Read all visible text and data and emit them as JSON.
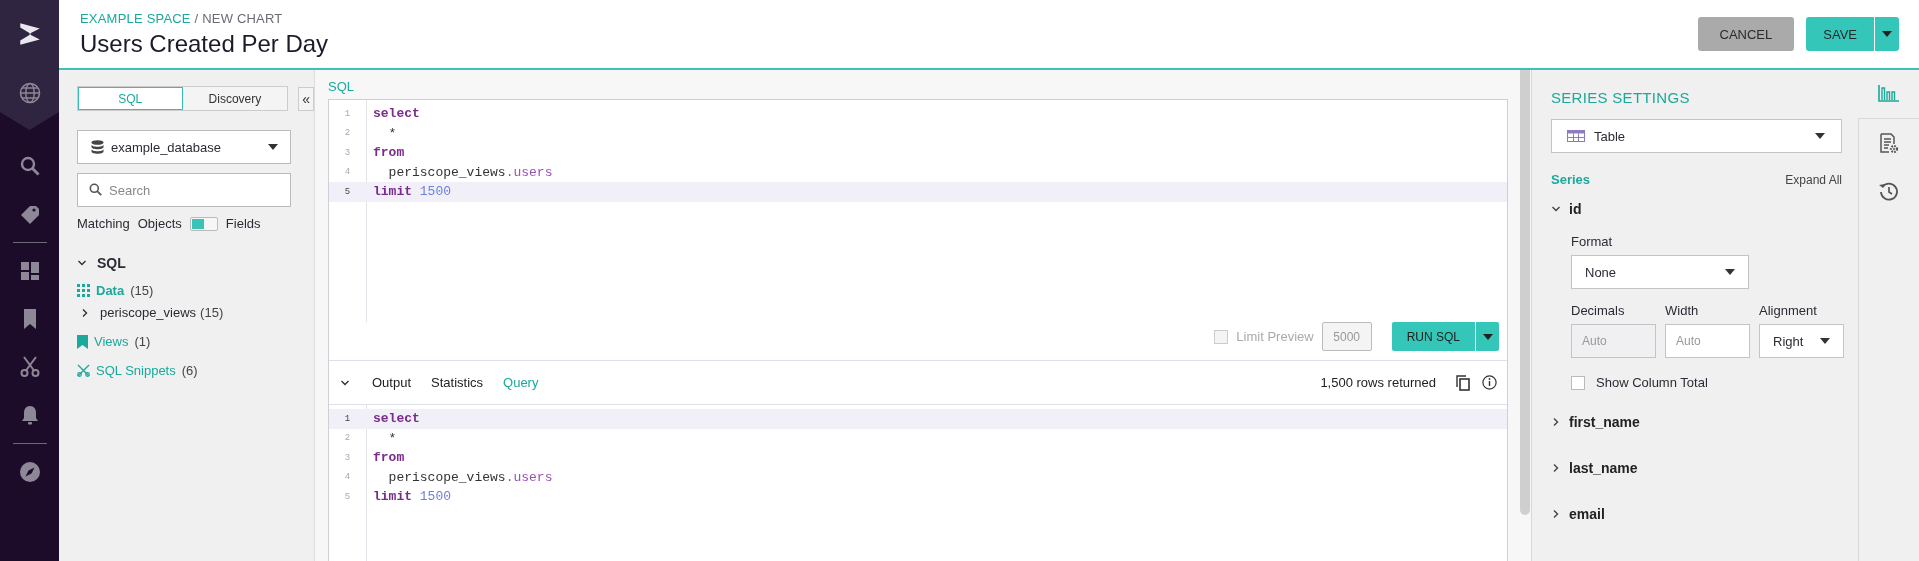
{
  "header": {
    "breadcrumb": {
      "space": "EXAMPLE SPACE",
      "page": "/ NEW CHART"
    },
    "title": "Users Created Per Day",
    "cancel": "CANCEL",
    "save": "SAVE"
  },
  "left_panel": {
    "modes": [
      {
        "label": "SQL",
        "selected": true
      },
      {
        "label": "Discovery",
        "selected": false
      }
    ],
    "collapse": "«",
    "database": "example_database",
    "search": {
      "placeholder": "Search"
    },
    "matching": {
      "label": "Matching",
      "off_label": "Objects",
      "on_label": "Fields",
      "on": false
    },
    "tree": {
      "label": "SQL",
      "expanded": true,
      "groups": [
        {
          "kind": "data",
          "label": "Data",
          "count": "(15)",
          "children": [
            {
              "label": "periscope_views",
              "count": "(15)",
              "expanded": false
            }
          ]
        },
        {
          "kind": "views",
          "label": "Views",
          "count": "(1)"
        },
        {
          "kind": "snippets",
          "label": "SQL Snippets",
          "count": "(6)"
        }
      ]
    }
  },
  "editor": {
    "label": "SQL",
    "lines": [
      {
        "number": "1",
        "current": false,
        "tokens": [
          {
            "kind": "keyword",
            "text": "select"
          }
        ]
      },
      {
        "number": "2",
        "current": false,
        "tokens": [
          {
            "kind": "plain",
            "text": "  *"
          }
        ]
      },
      {
        "number": "3",
        "current": false,
        "tokens": [
          {
            "kind": "keyword",
            "text": "from"
          }
        ]
      },
      {
        "number": "4",
        "current": false,
        "tokens": [
          {
            "kind": "plain",
            "text": "  periscope_views"
          },
          {
            "kind": "member",
            "text": ".users"
          }
        ]
      },
      {
        "number": "5",
        "current": true,
        "tokens": [
          {
            "kind": "keyword",
            "text": "limit"
          },
          {
            "kind": "number",
            "text": "1500"
          }
        ]
      }
    ],
    "limit_preview": {
      "label": "Limit Preview",
      "checked": false,
      "disabled": true,
      "value": "5000"
    },
    "run": "RUN SQL"
  },
  "output": {
    "expanded": true,
    "tabs": [
      {
        "label": "Output",
        "selected": false
      },
      {
        "label": "Statistics",
        "selected": false
      },
      {
        "label": "Query",
        "selected": true
      }
    ],
    "status": "1,500 rows returned",
    "lines": [
      {
        "number": "1",
        "current": true,
        "tokens": [
          {
            "kind": "keyword",
            "text": "select"
          }
        ]
      },
      {
        "number": "2",
        "current": false,
        "tokens": [
          {
            "kind": "plain",
            "text": "  *"
          }
        ]
      },
      {
        "number": "3",
        "current": false,
        "tokens": [
          {
            "kind": "keyword",
            "text": "from"
          }
        ]
      },
      {
        "number": "4",
        "current": false,
        "tokens": [
          {
            "kind": "plain",
            "text": "  periscope_views"
          },
          {
            "kind": "member",
            "text": ".users"
          }
        ]
      },
      {
        "number": "5",
        "current": false,
        "tokens": [
          {
            "kind": "keyword",
            "text": "limit"
          },
          {
            "kind": "number",
            "text": "1500"
          }
        ]
      }
    ]
  },
  "series_settings": {
    "title": "SERIES SETTINGS",
    "chart_type": "Table",
    "series_label": "Series",
    "expand_all": "Expand All",
    "series": [
      {
        "name": "id",
        "expanded": true,
        "format": {
          "label": "Format",
          "value": "None"
        },
        "decimals": {
          "label": "Decimals",
          "placeholder": "Auto",
          "disabled": true
        },
        "width": {
          "label": "Width",
          "placeholder": "Auto",
          "disabled": false
        },
        "alignment": {
          "label": "Alignment",
          "value": "Right"
        },
        "column_total": {
          "label": "Show Column Total",
          "checked": false
        }
      },
      {
        "name": "first_name",
        "expanded": false
      },
      {
        "name": "last_name",
        "expanded": false
      },
      {
        "name": "email",
        "expanded": false
      }
    ]
  },
  "side_tabs": [
    {
      "kind": "chart",
      "selected": true
    },
    {
      "kind": "settings",
      "selected": false
    },
    {
      "kind": "history",
      "selected": false
    }
  ]
}
